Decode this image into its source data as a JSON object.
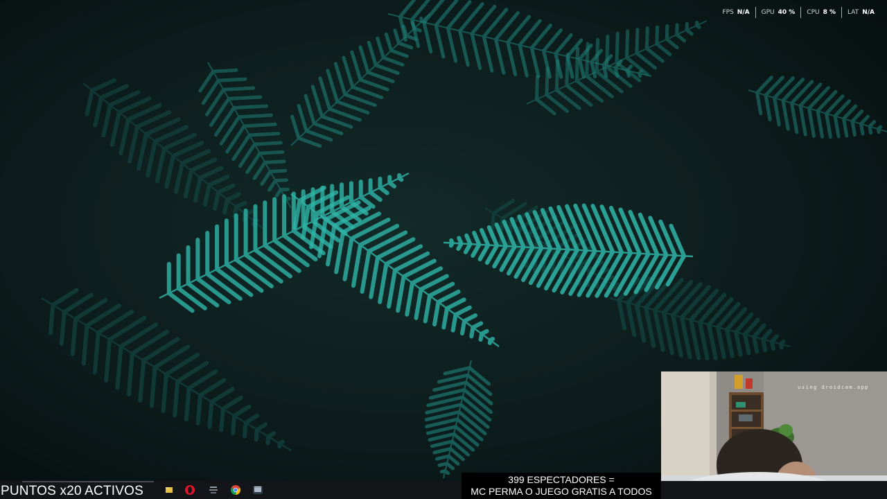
{
  "overlay": {
    "fps_label": "FPS",
    "fps_value": "N/A",
    "gpu_label": "GPU",
    "gpu_value": "40 %",
    "cpu_label": "CPU",
    "cpu_value": "8 %",
    "lat_label": "LAT",
    "lat_value": "N/A"
  },
  "webcam": {
    "watermark": "using droidcam.app"
  },
  "stream": {
    "points_text": "PUNTOS x20 ACTIVOS",
    "viewers_line1": "399 ESPECTADORES =",
    "viewers_line2": "MC PERMA O JUEGO GRATIS A TODOS"
  },
  "taskbar": {
    "apps": [
      "file-explorer-icon",
      "opera-icon",
      "app-icon",
      "chrome-icon",
      "media-icon"
    ]
  },
  "colors": {
    "fern": "#2fb5a8",
    "background": "#0a1414"
  }
}
